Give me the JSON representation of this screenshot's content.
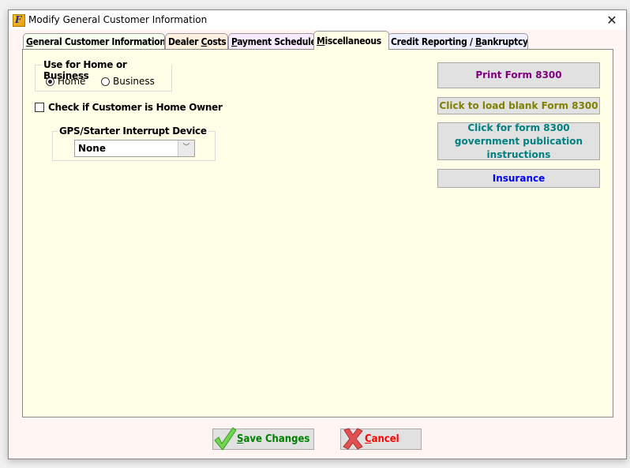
{
  "window": {
    "title": "Modify General Customer Information",
    "app_icon_glyph": "F",
    "close_glyph": "✕"
  },
  "tabs": [
    {
      "label_pre": "",
      "label_ul": "G",
      "label_post": "eneral Customer Information",
      "bg": "#f8fff0",
      "active": false
    },
    {
      "label_pre": "Dealer ",
      "label_ul": "C",
      "label_post": "osts",
      "bg": "#fff0e0",
      "active": false
    },
    {
      "label_pre": "",
      "label_ul": "P",
      "label_post": "ayment Schedule",
      "bg": "#f8eaff",
      "active": false
    },
    {
      "label_pre": "",
      "label_ul": "M",
      "label_post": "iscellaneous",
      "bg": "#ffffe8",
      "active": true
    },
    {
      "label_pre": "Credit Reporting / ",
      "label_ul": "B",
      "label_post": "ankruptcy",
      "bg": "#eef0ff",
      "active": false
    }
  ],
  "home_business": {
    "legend": "Use for Home or Business",
    "options": [
      {
        "label": "Home",
        "selected": true
      },
      {
        "label": "Business",
        "selected": false
      }
    ]
  },
  "home_owner_checkbox": {
    "label": "Check if Customer is Home Owner",
    "checked": false
  },
  "gps_device": {
    "legend": "GPS/Starter Interrupt Device",
    "selected": "None",
    "arrow_glyph": "﹀"
  },
  "side_buttons": [
    {
      "label": "Print Form 8300",
      "color": "#800080"
    },
    {
      "label": "Click to load blank Form 8300",
      "color": "#808000"
    },
    {
      "label": "Click for form 8300 government publication instructions",
      "color": "#008080"
    },
    {
      "label": "Insurance",
      "color": "#0000ff"
    }
  ],
  "footer": {
    "save": {
      "ul": "S",
      "rest": "ave Changes",
      "color": "#008000"
    },
    "cancel": {
      "ul": "C",
      "rest": "ancel",
      "color": "#ff0000"
    }
  }
}
